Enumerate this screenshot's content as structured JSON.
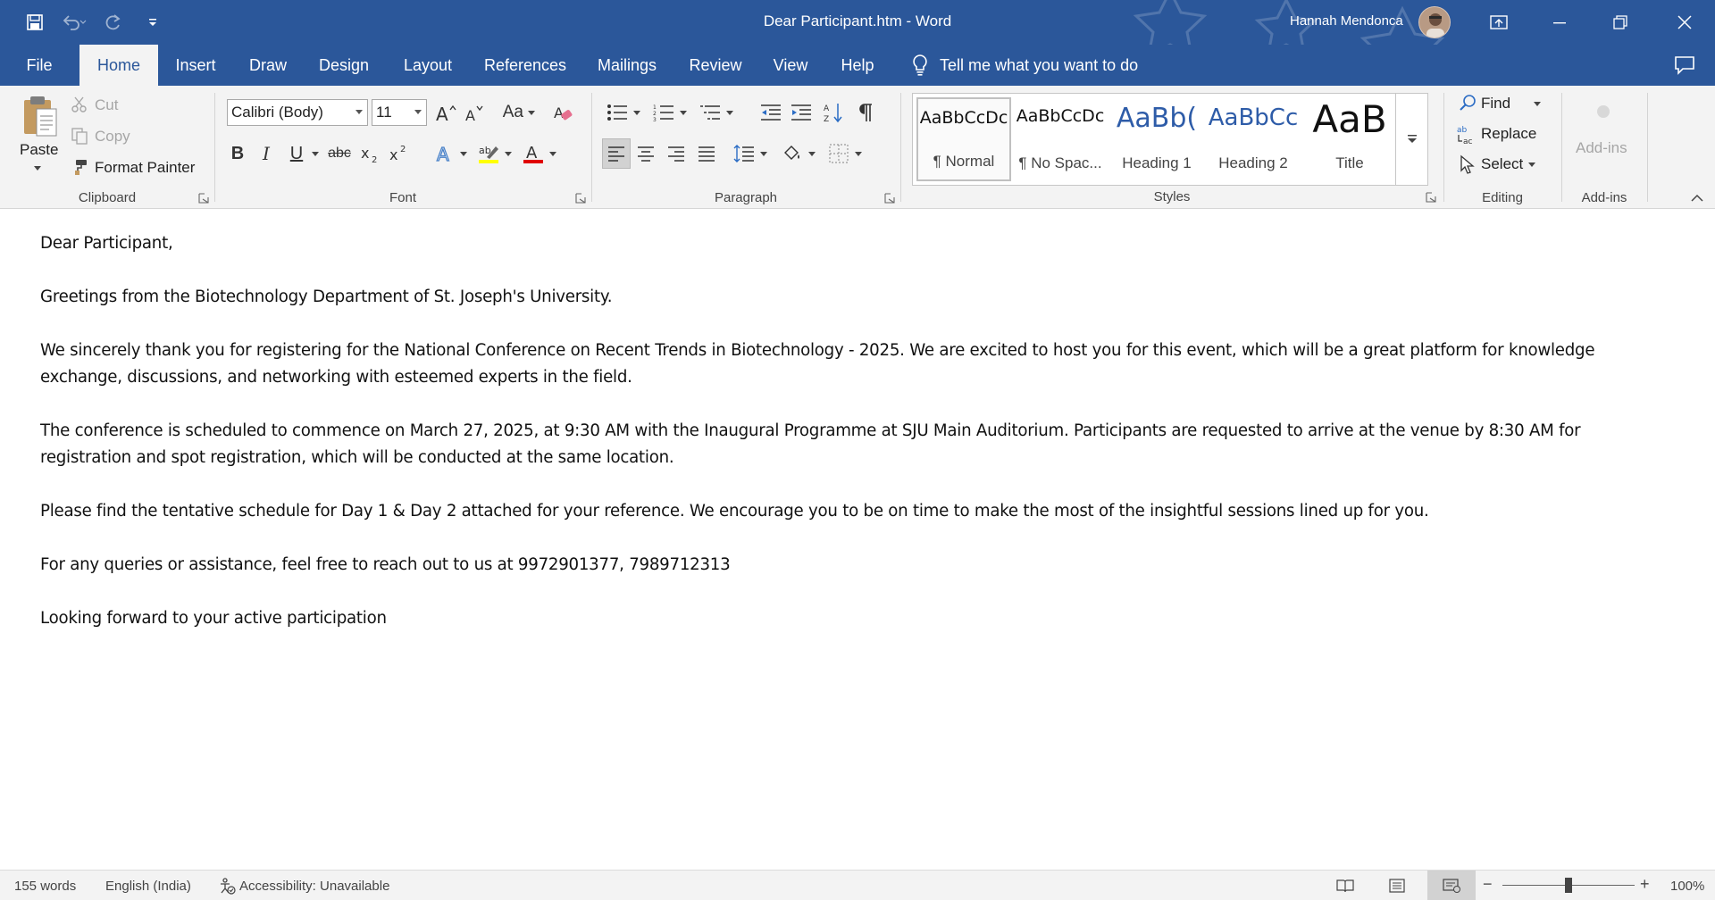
{
  "window": {
    "title": "Dear Participant.htm  -  Word",
    "user_name": "Hannah Mendonca",
    "accent_color": "#2b579a"
  },
  "tabs": [
    "File",
    "Home",
    "Insert",
    "Draw",
    "Design",
    "Layout",
    "References",
    "Mailings",
    "Review",
    "View",
    "Help"
  ],
  "active_tab": "Home",
  "tell_me": "Tell me what you want to do",
  "ribbon": {
    "clipboard": {
      "paste": "Paste",
      "cut": "Cut",
      "copy": "Copy",
      "format_painter": "Format Painter",
      "label": "Clipboard"
    },
    "font": {
      "font_name": "Calibri (Body)",
      "font_size": "11",
      "change_case": "Aa",
      "label": "Font"
    },
    "paragraph": {
      "label": "Paragraph"
    },
    "styles": {
      "items": [
        {
          "sample": "AaBbCcDc",
          "name": "¶ Normal"
        },
        {
          "sample": "AaBbCcDc",
          "name": "¶ No Spac..."
        },
        {
          "sample": "AaBb(",
          "name": "Heading 1"
        },
        {
          "sample": "AaBbCc",
          "name": "Heading 2"
        },
        {
          "sample": "AaB",
          "name": "Title"
        }
      ],
      "label": "Styles"
    },
    "editing": {
      "find": "Find",
      "replace": "Replace",
      "select": "Select",
      "label": "Editing"
    },
    "addins": {
      "button": "Add-ins",
      "label": "Add-ins"
    }
  },
  "document": {
    "paragraphs": [
      "Dear Participant,",
      "Greetings from the Biotechnology Department of St. Joseph's University.",
      "We sincerely thank you for registering for the National Conference on Recent Trends in Biotechnology - 2025. We are excited to host you for this event, which will be a great platform for knowledge exchange, discussions, and networking with esteemed experts in the field.",
      "The conference is scheduled to commence on March 27, 2025, at 9:30 AM with the Inaugural Programme at SJU Main Auditorium. Participants are requested to arrive at the venue by 8:30 AM for registration and spot registration, which will be conducted at the same location.",
      "Please find the tentative schedule for Day 1 & Day 2 attached for your reference. We encourage you to be on time to make the most of the insightful sessions lined up for you.",
      "For any queries or assistance, feel free to reach out to us at 9972901377, 7989712313",
      "Looking forward to your active participation"
    ]
  },
  "status": {
    "words": "155 words",
    "language": "English (India)",
    "accessibility": "Accessibility: Unavailable",
    "zoom": "100%",
    "zoom_minus": "−",
    "zoom_plus": "+"
  }
}
